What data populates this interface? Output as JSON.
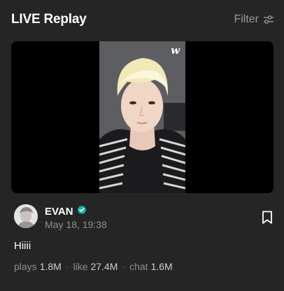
{
  "header": {
    "title": "LIVE Replay",
    "filter_label": "Filter"
  },
  "video": {
    "watermark": "w"
  },
  "post": {
    "author": "EVAN",
    "date": "May 18, 19:38",
    "caption": "Hiiii",
    "stats": [
      {
        "label": "plays",
        "value": "1.8M"
      },
      {
        "label": "like",
        "value": "27.4M"
      },
      {
        "label": "chat",
        "value": "1.6M"
      }
    ]
  },
  "colors": {
    "background": "#252525",
    "verified_badge": "#0fb8ae",
    "muted_text": "#8e8e8e"
  }
}
